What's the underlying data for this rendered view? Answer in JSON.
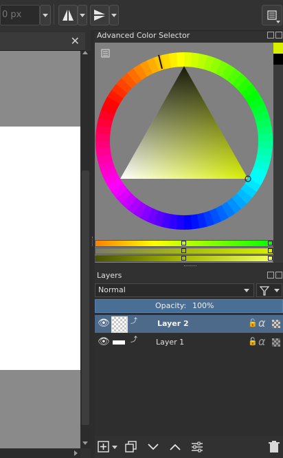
{
  "toolbar": {
    "size_value": "0 px",
    "icons": [
      "mirror-horizontal-icon",
      "mirror-vertical-icon",
      "workspace-icon"
    ]
  },
  "color_selector": {
    "title": "Advanced Color Selector",
    "current_color": "#d7ef00",
    "hue_degrees": 66,
    "slider_positions": [
      0.5,
      0.5,
      0.5
    ]
  },
  "layers": {
    "title": "Layers",
    "blend_mode": "Normal",
    "opacity_label": "Opacity:",
    "opacity_value": "100%",
    "opacity_fraction": 1.0,
    "items": [
      {
        "name": "Layer 2",
        "selected": true
      },
      {
        "name": "Layer 1",
        "selected": false
      }
    ]
  },
  "colors": {
    "accent": "#4a6f96",
    "selected_row": "#4d6a8a"
  }
}
